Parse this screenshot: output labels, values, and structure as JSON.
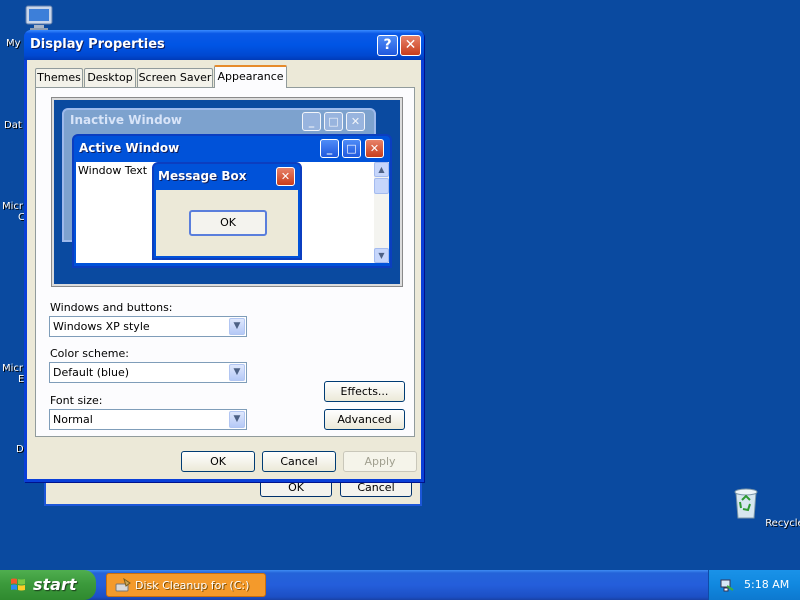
{
  "desktop": {
    "icons": [
      {
        "label": "My",
        "name": "my-computer"
      },
      {
        "label": "Dat",
        "name": "data"
      },
      {
        "label": "Micr",
        "label2": "C",
        "name": "microsoft-1"
      },
      {
        "label": "Micr",
        "label2": "E",
        "name": "microsoft-2"
      },
      {
        "label": "D",
        "name": "d-icon"
      }
    ],
    "recycle_bin": "Recycle Bin"
  },
  "back_window": {
    "ok_label": "OK",
    "cancel_label": "Cancel"
  },
  "dialog": {
    "title": "Display Properties",
    "help_glyph": "?",
    "close_glyph": "✕",
    "tabs": [
      "Themes",
      "Desktop",
      "Screen Saver",
      "Appearance"
    ],
    "active_tab": "Appearance",
    "preview": {
      "inactive_title": "Inactive Window",
      "active_title": "Active Window",
      "window_text": "Window Text",
      "message_title": "Message Box",
      "message_ok": "OK"
    },
    "windows_buttons": {
      "label": "Windows and buttons:",
      "value": "Windows XP style"
    },
    "color_scheme": {
      "label": "Color scheme:",
      "value": "Default (blue)"
    },
    "font_size": {
      "label": "Font size:",
      "value": "Normal"
    },
    "effects_label": "Effects...",
    "advanced_label": "Advanced",
    "ok_label": "OK",
    "cancel_label": "Cancel",
    "apply_label": "Apply"
  },
  "taskbar": {
    "start_label": "start",
    "task_label": "Disk Cleanup for  (C:)",
    "clock": "5:18 AM"
  }
}
